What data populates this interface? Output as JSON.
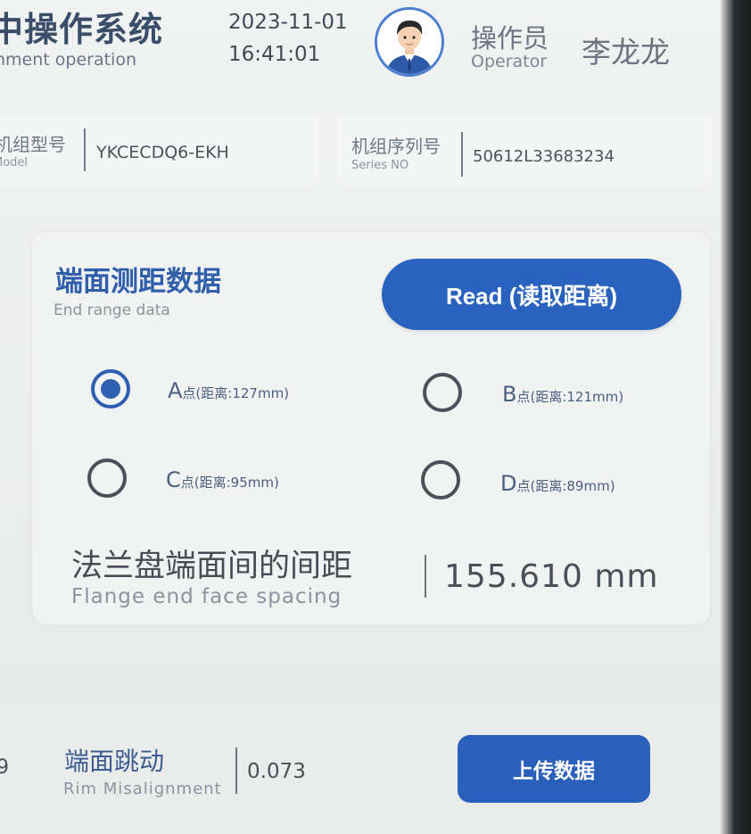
{
  "header": {
    "app_title": "中操作系统",
    "app_subtitle": "nment operation",
    "date": "2023-11-01",
    "time": "16:41:01",
    "operator_label": "操作员",
    "operator_label_en": "Operator",
    "operator_name": "李龙龙"
  },
  "unit_info": {
    "model_label": "机组型号",
    "model_label_en": "Model",
    "model_value": "YKCECDQ6-EKH",
    "serial_label": "机组序列号",
    "serial_label_en": "Series NO",
    "serial_value": "50612L33683234"
  },
  "end_range": {
    "title": "端面测距数据",
    "subtitle": "End range data",
    "read_button": "Read (读取距离)",
    "points": [
      {
        "letter": "A",
        "text": "点(距离:127mm)",
        "selected": true
      },
      {
        "letter": "B",
        "text": "点(距离:121mm)",
        "selected": false
      },
      {
        "letter": "C",
        "text": "点(距离:95mm)",
        "selected": false
      },
      {
        "letter": "D",
        "text": "点(距离:89mm)",
        "selected": false
      }
    ],
    "flange_title": "法兰盘端面间的间距",
    "flange_subtitle": "Flange end face spacing",
    "flange_value": "155.610 mm"
  },
  "rim": {
    "edge_value": "9",
    "title": "端面跳动",
    "subtitle": "Rim Misalignment",
    "value": "0.073",
    "upload_button": "上传数据"
  },
  "colors": {
    "accent": "#2a63bf",
    "title_blue": "#2f5faa",
    "background": "#eceded"
  }
}
